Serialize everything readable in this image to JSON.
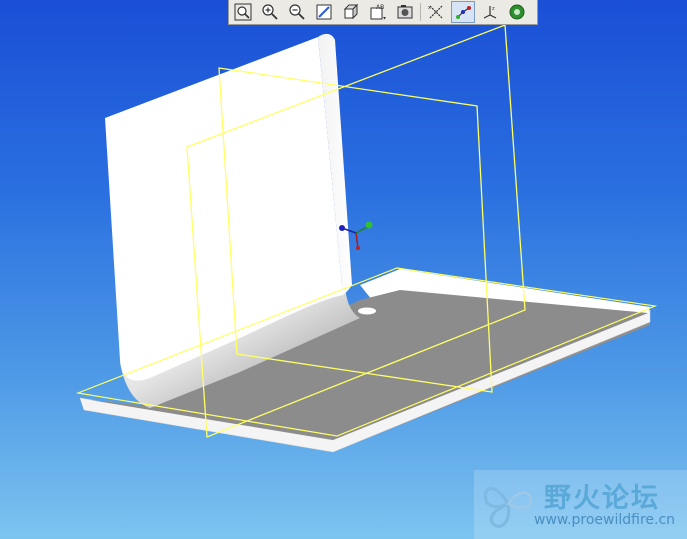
{
  "toolbar": {
    "buttons": [
      {
        "icon": "zoom-fit-icon"
      },
      {
        "icon": "zoom-in-icon"
      },
      {
        "icon": "zoom-out-icon"
      },
      {
        "icon": "repaint-icon"
      },
      {
        "icon": "view-orient-icon"
      },
      {
        "icon": "saved-views-icon"
      },
      {
        "icon": "layers-icon"
      },
      {
        "icon": "datum-planes-icon"
      },
      {
        "icon": "datum-axes-icon"
      },
      {
        "icon": "datum-csys-icon"
      },
      {
        "icon": "appearance-icon"
      }
    ]
  },
  "colors": {
    "background_top": "#1a4fd6",
    "background_bottom": "#7cc4f0",
    "part_surface": "#ffffff",
    "part_shadow": "#8c8c8c",
    "datum_plane": "#ffff66"
  },
  "watermark": {
    "title": "野火论坛",
    "url": "www.proewildfire.cn"
  }
}
